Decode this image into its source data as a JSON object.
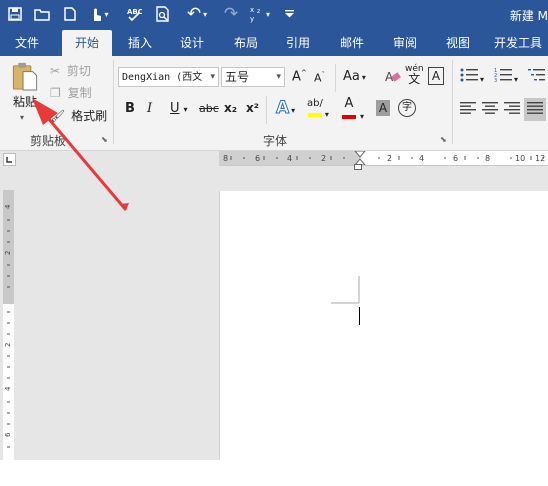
{
  "window": {
    "title": "新建 M"
  },
  "qat": {
    "undo_label": "↶",
    "redo_label": "↷"
  },
  "tabs": [
    "文件",
    "开始",
    "插入",
    "设计",
    "布局",
    "引用",
    "邮件",
    "审阅",
    "视图",
    "开发工具"
  ],
  "active_tab": "开始",
  "clipboard": {
    "paste_label": "粘贴",
    "cut_label": "剪切",
    "copy_label": "复制",
    "format_painter_label": "格式刷",
    "group_label": "剪贴板"
  },
  "font": {
    "font_name": "DengXian (西文",
    "font_size": "五号",
    "group_label": "字体",
    "bold": "B",
    "italic": "I",
    "underline": "U",
    "strike": "abc",
    "subscript": "x₂",
    "superscript": "x²",
    "change_case": "Aa",
    "font_color_letter": "A",
    "phonetic": "wén",
    "enclose": "字"
  },
  "colors": {
    "ribbon_blue": "#2b579a",
    "highlight_yellow": "#ffff00",
    "font_red": "#e00000",
    "annotation_arrow": "#e83a3a"
  }
}
